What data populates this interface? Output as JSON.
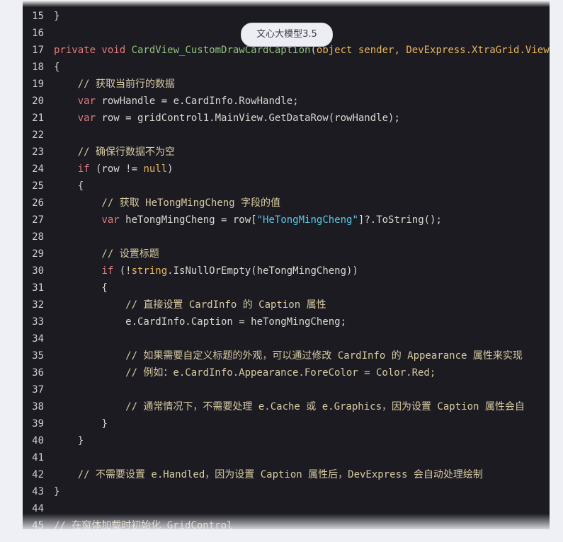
{
  "badge": {
    "label": "文心大模型3.5"
  },
  "code": {
    "lines": [
      {
        "n": "15",
        "tokens": [
          {
            "t": "}",
            "c": "pl"
          }
        ]
      },
      {
        "n": "16",
        "tokens": []
      },
      {
        "n": "17",
        "tokens": [
          {
            "t": "private void ",
            "c": "kw"
          },
          {
            "t": "CardView_CustomDrawCardCaption",
            "c": "fn"
          },
          {
            "t": "(",
            "c": "pl"
          },
          {
            "t": "object",
            "c": "ty"
          },
          {
            "t": " sender, DevExpress.XtraGrid.Views.",
            "c": "ty"
          }
        ]
      },
      {
        "n": "18",
        "tokens": [
          {
            "t": "{",
            "c": "pl"
          }
        ]
      },
      {
        "n": "19",
        "tokens": [
          {
            "t": "    // 获取当前行的数据",
            "c": "cm"
          }
        ]
      },
      {
        "n": "20",
        "tokens": [
          {
            "t": "    ",
            "c": "pl"
          },
          {
            "t": "var",
            "c": "kw"
          },
          {
            "t": " rowHandle = e.CardInfo.RowHandle;",
            "c": "pl"
          }
        ]
      },
      {
        "n": "21",
        "tokens": [
          {
            "t": "    ",
            "c": "pl"
          },
          {
            "t": "var",
            "c": "kw"
          },
          {
            "t": " row = gridControl1.MainView.GetDataRow(rowHandle);",
            "c": "pl"
          }
        ]
      },
      {
        "n": "22",
        "tokens": []
      },
      {
        "n": "23",
        "tokens": [
          {
            "t": "    // 确保行数据不为空",
            "c": "cm"
          }
        ]
      },
      {
        "n": "24",
        "tokens": [
          {
            "t": "    ",
            "c": "pl"
          },
          {
            "t": "if",
            "c": "kw"
          },
          {
            "t": " (row != ",
            "c": "pl"
          },
          {
            "t": "null",
            "c": "ty"
          },
          {
            "t": ")",
            "c": "pl"
          }
        ]
      },
      {
        "n": "25",
        "tokens": [
          {
            "t": "    {",
            "c": "pl"
          }
        ]
      },
      {
        "n": "26",
        "tokens": [
          {
            "t": "        // 获取 HeTongMingCheng 字段的值",
            "c": "cm"
          }
        ]
      },
      {
        "n": "27",
        "tokens": [
          {
            "t": "        ",
            "c": "pl"
          },
          {
            "t": "var",
            "c": "kw"
          },
          {
            "t": " heTongMingCheng = row[",
            "c": "pl"
          },
          {
            "t": "\"HeTongMingCheng\"",
            "c": "str"
          },
          {
            "t": "]?.ToString();",
            "c": "pl"
          }
        ]
      },
      {
        "n": "28",
        "tokens": []
      },
      {
        "n": "29",
        "tokens": [
          {
            "t": "        // 设置标题",
            "c": "cm"
          }
        ]
      },
      {
        "n": "30",
        "tokens": [
          {
            "t": "        ",
            "c": "pl"
          },
          {
            "t": "if",
            "c": "kw"
          },
          {
            "t": " (!",
            "c": "pl"
          },
          {
            "t": "string",
            "c": "ty"
          },
          {
            "t": ".IsNullOrEmpty(heTongMingCheng))",
            "c": "pl"
          }
        ]
      },
      {
        "n": "31",
        "tokens": [
          {
            "t": "        {",
            "c": "pl"
          }
        ]
      },
      {
        "n": "32",
        "tokens": [
          {
            "t": "            // 直接设置 CardInfo 的 Caption 属性",
            "c": "cm"
          }
        ]
      },
      {
        "n": "33",
        "tokens": [
          {
            "t": "            e.CardInfo.Caption = heTongMingCheng;",
            "c": "pl"
          }
        ]
      },
      {
        "n": "34",
        "tokens": []
      },
      {
        "n": "35",
        "tokens": [
          {
            "t": "            // 如果需要自定义标题的外观，可以通过修改 CardInfo 的 Appearance 属性来实现",
            "c": "cm"
          }
        ]
      },
      {
        "n": "36",
        "tokens": [
          {
            "t": "            // 例如：e.CardInfo.Appearance.ForeColor = Color.Red;",
            "c": "cm"
          }
        ]
      },
      {
        "n": "37",
        "tokens": []
      },
      {
        "n": "38",
        "tokens": [
          {
            "t": "            // 通常情况下，不需要处理 e.Cache 或 e.Graphics，因为设置 Caption 属性会自",
            "c": "cm"
          }
        ]
      },
      {
        "n": "39",
        "tokens": [
          {
            "t": "        }",
            "c": "pl"
          }
        ]
      },
      {
        "n": "40",
        "tokens": [
          {
            "t": "    }",
            "c": "pl"
          }
        ]
      },
      {
        "n": "41",
        "tokens": []
      },
      {
        "n": "42",
        "tokens": [
          {
            "t": "    // 不需要设置 e.Handled，因为设置 Caption 属性后，DevExpress 会自动处理绘制",
            "c": "cm"
          }
        ]
      },
      {
        "n": "43",
        "tokens": [
          {
            "t": "}",
            "c": "pl"
          }
        ]
      },
      {
        "n": "44",
        "tokens": []
      },
      {
        "n": "45",
        "tokens": [
          {
            "t": "// 在窗体加载时初始化 GridControl",
            "c": "cm"
          }
        ]
      }
    ]
  }
}
